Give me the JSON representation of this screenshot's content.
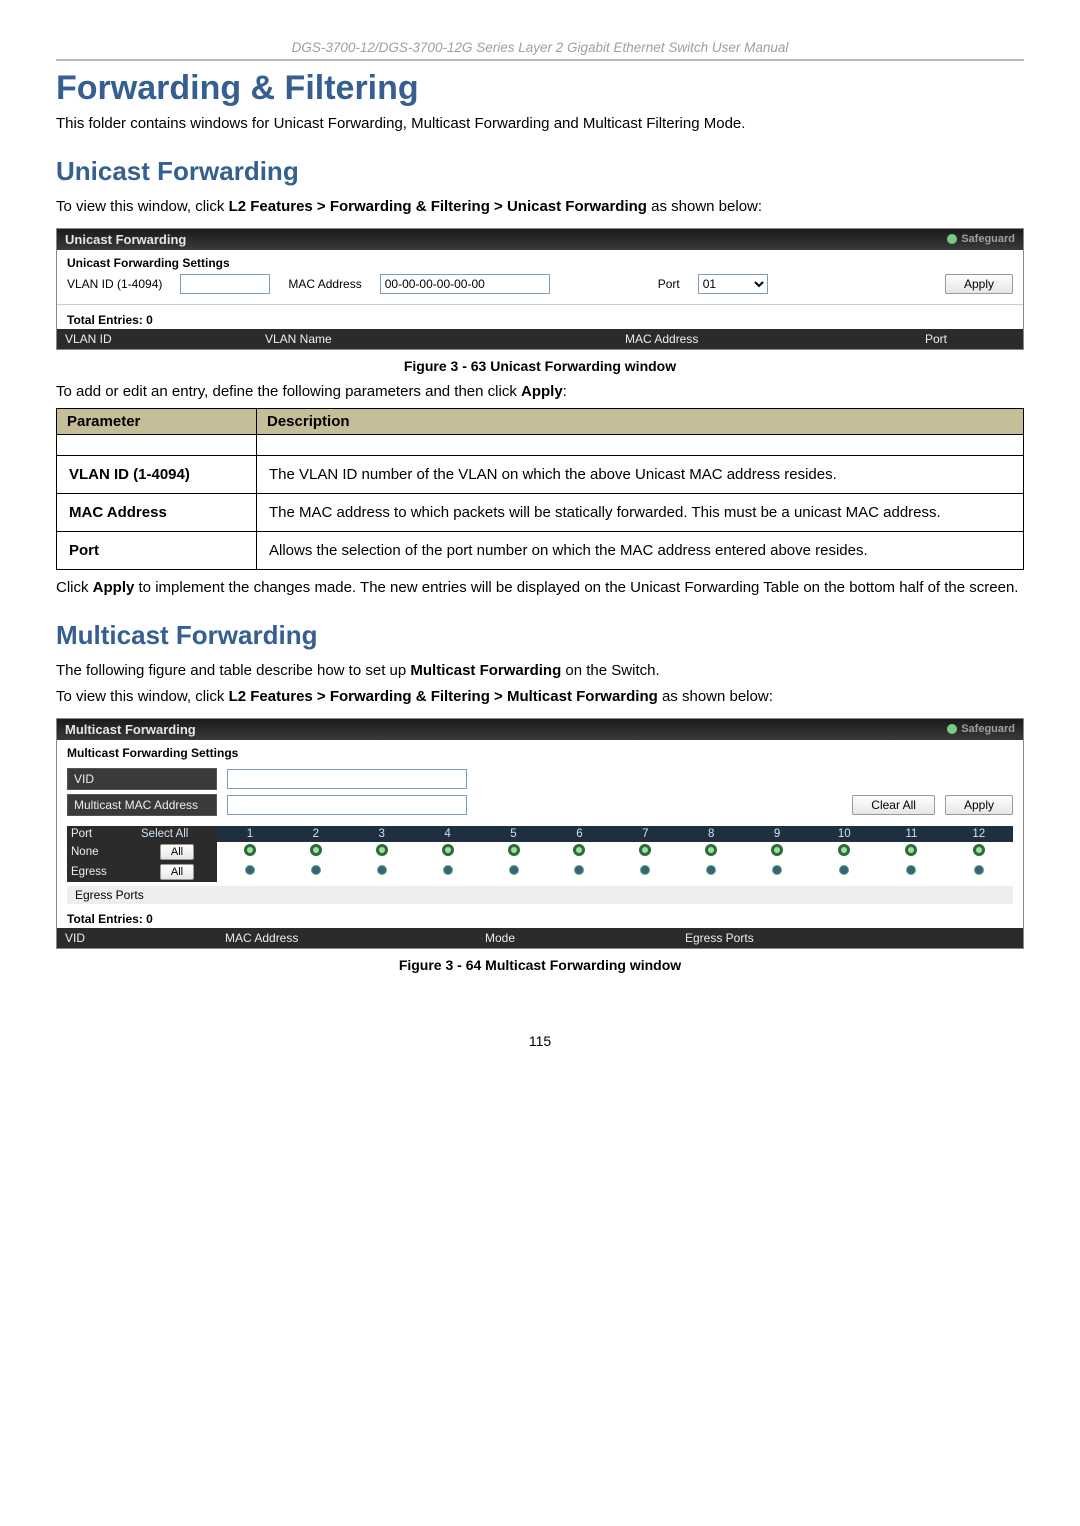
{
  "header_manual": "DGS-3700-12/DGS-3700-12G Series Layer 2 Gigabit Ethernet Switch User Manual",
  "h1": "Forwarding & Filtering",
  "intro_p": "This folder contains windows for Unicast Forwarding, Multicast Forwarding and Multicast Filtering Mode.",
  "h2_unicast": "Unicast Forwarding",
  "unicast_view_pre": "To view this window, click ",
  "unicast_view_path": "L2 Features > Forwarding & Filtering > Unicast Forwarding",
  "unicast_view_post": " as shown below:",
  "uni_panel": {
    "title": "Unicast Forwarding",
    "safeguard": "Safeguard",
    "settings_title": "Unicast Forwarding Settings",
    "vlan_label": "VLAN ID (1-4094)",
    "vlan_value": "",
    "mac_label": "MAC Address",
    "mac_value": "00-00-00-00-00-00",
    "port_label": "Port",
    "port_value": "01",
    "apply_label": "Apply",
    "total_label": "Total Entries: 0",
    "cols": {
      "c1": "VLAN ID",
      "c2": "VLAN Name",
      "c3": "MAC Address",
      "c4": "Port"
    }
  },
  "fig63": "Figure 3 - 63 Unicast Forwarding window",
  "add_edit_pre": "To add or edit an entry, define the following parameters and then click ",
  "add_edit_bold": "Apply",
  "add_edit_post": ":",
  "ptable": {
    "h_param": "Parameter",
    "h_desc": "Description",
    "rows": [
      {
        "param": "VLAN ID (1-4094)",
        "desc": "The VLAN ID number of the VLAN on which the above Unicast MAC address resides."
      },
      {
        "param": "MAC Address",
        "desc": "The MAC address to which packets will be statically forwarded. This must be a unicast MAC address."
      },
      {
        "param": "Port",
        "desc": "Allows the selection of the port number on which the MAC address entered above resides."
      }
    ]
  },
  "click_apply_pre": "Click ",
  "click_apply_bold": "Apply",
  "click_apply_post": " to implement the changes made. The new entries will be displayed on the Unicast Forwarding Table on the bottom half of the screen.",
  "h2_multicast": "Multicast Forwarding",
  "mc_intro_pre": "The following figure and table describe how to set up ",
  "mc_intro_bold": "Multicast Forwarding",
  "mc_intro_post": " on the Switch.",
  "mc_view_pre": "To view this window, click ",
  "mc_view_path": "L2 Features > Forwarding & Filtering > Multicast Forwarding",
  "mc_view_post": " as shown below:",
  "mc_panel": {
    "title": "Multicast Forwarding",
    "safeguard": "Safeguard",
    "settings_title": "Multicast Forwarding Settings",
    "vid_label": "VID",
    "vid_value": "",
    "mac_label": "Multicast MAC Address",
    "mac_value": "",
    "clear_all": "Clear All",
    "apply": "Apply",
    "port_hdr": "Port",
    "select_all": "Select All",
    "ports": [
      "1",
      "2",
      "3",
      "4",
      "5",
      "6",
      "7",
      "8",
      "9",
      "10",
      "11",
      "12"
    ],
    "row_none": "None",
    "row_egress": "Egress",
    "all_btn": "All",
    "egress_ports_row": "Egress Ports",
    "total_label": "Total Entries: 0",
    "cols": {
      "c1": "VID",
      "c2": "MAC Address",
      "c3": "Mode",
      "c4": "Egress Ports"
    }
  },
  "fig64": "Figure 3 - 64 Multicast Forwarding window",
  "page_num": "115"
}
